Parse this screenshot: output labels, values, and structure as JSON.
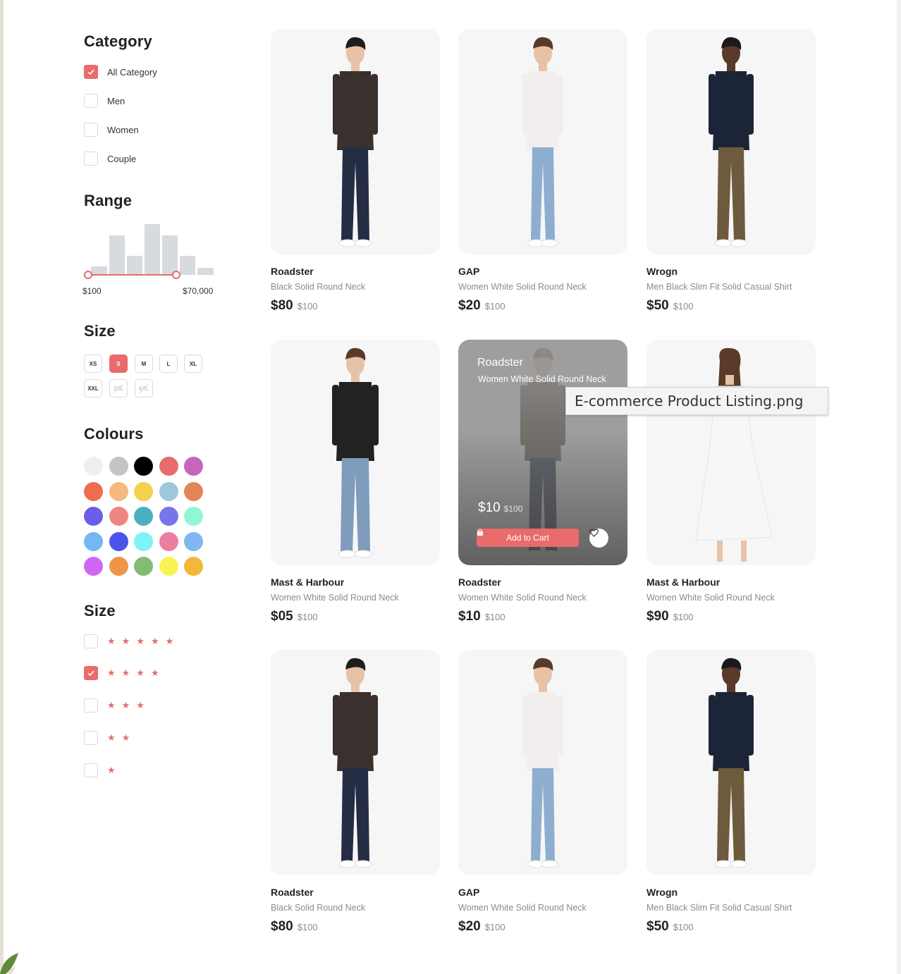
{
  "filters": {
    "category": {
      "title": "Category",
      "items": [
        {
          "label": "All Category",
          "checked": true
        },
        {
          "label": "Men",
          "checked": false
        },
        {
          "label": "Women",
          "checked": false
        },
        {
          "label": "Couple",
          "checked": false
        }
      ]
    },
    "range": {
      "title": "Range",
      "min_label": "$100",
      "max_label": "$70,000",
      "selected_fraction": [
        0.0,
        0.7
      ]
    },
    "size": {
      "title": "Size",
      "options": [
        {
          "label": "XS",
          "state": "normal"
        },
        {
          "label": "S",
          "state": "selected"
        },
        {
          "label": "M",
          "state": "normal"
        },
        {
          "label": "L",
          "state": "normal"
        },
        {
          "label": "XL",
          "state": "normal"
        },
        {
          "label": "XXL",
          "state": "normal"
        },
        {
          "label": "3XL",
          "state": "disabled"
        },
        {
          "label": "4XL",
          "state": "disabled"
        }
      ]
    },
    "colours": {
      "title": "Colours",
      "swatches": [
        "#efefef",
        "#c4c4c4",
        "#000000",
        "#e96b6b",
        "#c765b8",
        "#ef6c4f",
        "#f4b97e",
        "#f3d04e",
        "#9ec8da",
        "#e38556",
        "#6b5fe8",
        "#ef8582",
        "#4aafbf",
        "#7875ec",
        "#92f5d3",
        "#74b8f3",
        "#4c52ec",
        "#7ef3f8",
        "#ec7ea1",
        "#80b6f2",
        "#d066f3",
        "#ef9448",
        "#83bd73",
        "#f6f353",
        "#f3b73a"
      ]
    },
    "rating": {
      "title": "Size",
      "items": [
        {
          "stars": "★★★★★",
          "checked": false
        },
        {
          "stars": "★★★★",
          "checked": true
        },
        {
          "stars": "★★★",
          "checked": false
        },
        {
          "stars": "★★",
          "checked": false
        },
        {
          "stars": "★",
          "checked": false
        }
      ]
    }
  },
  "products": [
    {
      "brand": "Roadster",
      "desc": "Black Solid Round Neck",
      "price": "$80",
      "old_price": "$100",
      "figure": "man-jacket"
    },
    {
      "brand": "GAP",
      "desc": "Women White Solid Round Neck",
      "price": "$20",
      "old_price": "$100",
      "figure": "woman-jeans"
    },
    {
      "brand": "Wrogn",
      "desc": "Men Black Slim Fit Solid Casual Shirt",
      "price": "$50",
      "old_price": "$100",
      "figure": "man-shirt"
    },
    {
      "brand": "Mast & Harbour",
      "desc": "Women White Solid Round Neck",
      "price": "$05",
      "old_price": "$100",
      "figure": "woman-top"
    },
    {
      "brand": "Roadster",
      "desc": "Women White Solid Round Neck",
      "price": "$10",
      "old_price": "$100",
      "figure": "woman-jacket",
      "hovered": true,
      "cart_label": "Add to Cart"
    },
    {
      "brand": "Mast & Harbour",
      "desc": "Women White Solid Round Neck",
      "price": "$90",
      "old_price": "$100",
      "figure": "woman-dress"
    },
    {
      "brand": "Roadster",
      "desc": "Black Solid Round Neck",
      "price": "$80",
      "old_price": "$100",
      "figure": "man-jacket"
    },
    {
      "brand": "GAP",
      "desc": "Women White Solid Round Neck",
      "price": "$20",
      "old_price": "$100",
      "figure": "woman-jeans"
    },
    {
      "brand": "Wrogn",
      "desc": "Men Black Slim Fit Solid Casual Shirt",
      "price": "$50",
      "old_price": "$100",
      "figure": "man-shirt"
    }
  ],
  "tooltip": "E-commerce Product Listing.png",
  "colors": {
    "accent": "#e96b6b",
    "card_bg": "#f6f6f6",
    "muted_text": "#8b8b8b"
  }
}
